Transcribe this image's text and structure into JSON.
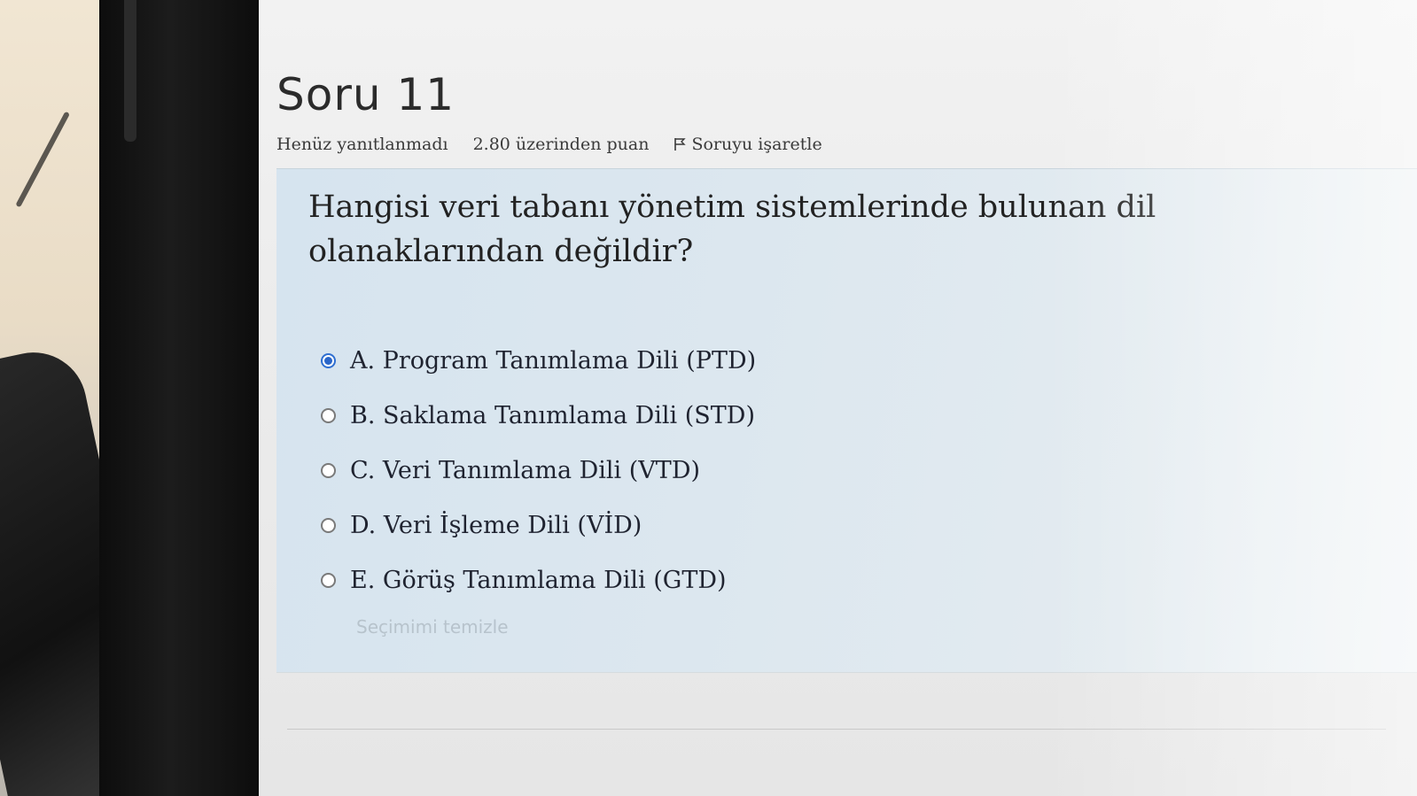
{
  "question": {
    "title": "Soru 11",
    "status": "Henüz yanıtlanmadı",
    "points": "2.80 üzerinden puan",
    "flag_label": "Soruyu işaretle",
    "flag_icon": "flag-icon",
    "text": "Hangisi veri tabanı yönetim sistemlerinde bulunan dil olanaklarından değildir?",
    "answers": [
      {
        "label": "A. Program Tanımlama Dili (PTD)",
        "selected": true
      },
      {
        "label": "B. Saklama Tanımlama Dili (STD)",
        "selected": false
      },
      {
        "label": "C. Veri Tanımlama Dili (VTD)",
        "selected": false
      },
      {
        "label": "D. Veri İşleme Dili (VİD)",
        "selected": false
      },
      {
        "label": "E. Görüş Tanımlama Dili (GTD)",
        "selected": false
      }
    ],
    "clear_label": "Seçimimi temizle"
  },
  "colors": {
    "radio_selected": "#2a66c9",
    "question_bg": "#d6e4ef",
    "clear_link": "#b7c3cc"
  }
}
